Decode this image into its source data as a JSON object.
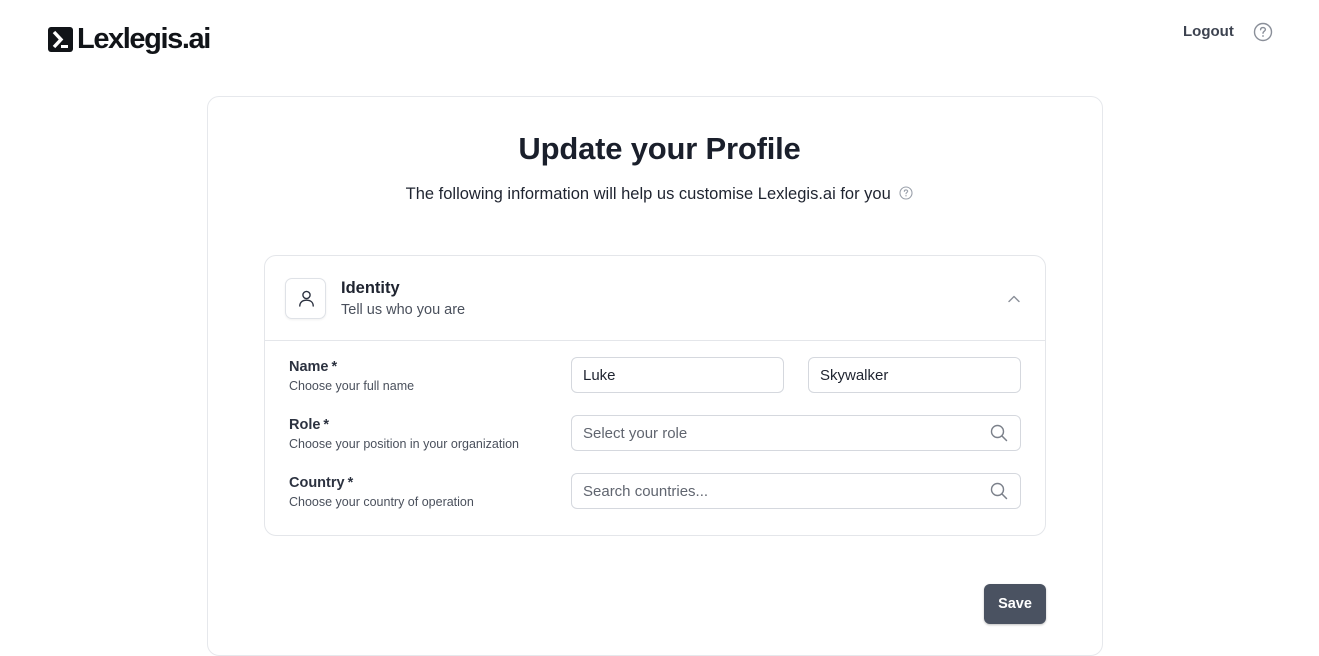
{
  "header": {
    "brand": "Lexlegis.ai",
    "logout_label": "Logout",
    "help_icon": "question-circle-icon"
  },
  "page": {
    "title": "Update your Profile",
    "subtitle": "The following information will help us customise Lexlegis.ai for you"
  },
  "identity": {
    "icon": "user-icon",
    "title": "Identity",
    "subtitle": "Tell us who you are",
    "expanded": true,
    "fields": {
      "name": {
        "label": "Name",
        "required_mark": "*",
        "hint": "Choose your full name",
        "first_value": "Luke",
        "last_value": "Skywalker"
      },
      "role": {
        "label": "Role",
        "required_mark": "*",
        "hint": "Choose your position in your organization",
        "placeholder": "Select your role",
        "value": ""
      },
      "country": {
        "label": "Country",
        "required_mark": "*",
        "hint": "Choose your country of operation",
        "placeholder": "Search countries...",
        "value": ""
      }
    }
  },
  "actions": {
    "save_label": "Save"
  },
  "colors": {
    "primary_button": "#4a5261",
    "border": "#e4e6ea",
    "text": "#1f2430"
  }
}
